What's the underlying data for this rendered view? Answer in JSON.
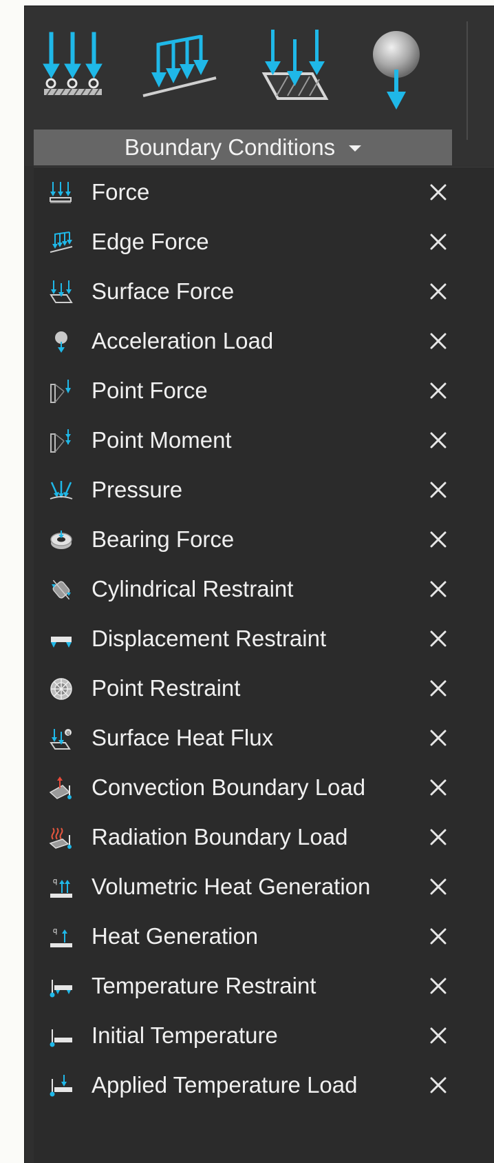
{
  "ribbon": {
    "group_label": "Boundary Conditions",
    "icons": [
      "force-icon",
      "edge-force-icon",
      "surface-force-icon",
      "acceleration-load-icon"
    ]
  },
  "menu": {
    "items": [
      {
        "label": "Force",
        "icon": "force-icon"
      },
      {
        "label": "Edge Force",
        "icon": "edge-force-icon"
      },
      {
        "label": "Surface Force",
        "icon": "surface-force-icon"
      },
      {
        "label": "Acceleration Load",
        "icon": "acceleration-load-icon"
      },
      {
        "label": "Point Force",
        "icon": "point-force-icon"
      },
      {
        "label": "Point Moment",
        "icon": "point-moment-icon"
      },
      {
        "label": "Pressure",
        "icon": "pressure-icon"
      },
      {
        "label": "Bearing Force",
        "icon": "bearing-force-icon"
      },
      {
        "label": "Cylindrical Restraint",
        "icon": "cylindrical-restraint-icon"
      },
      {
        "label": "Displacement Restraint",
        "icon": "displacement-restraint-icon"
      },
      {
        "label": "Point Restraint",
        "icon": "point-restraint-icon"
      },
      {
        "label": "Surface Heat Flux",
        "icon": "surface-heat-flux-icon"
      },
      {
        "label": "Convection Boundary Load",
        "icon": "convection-boundary-load-icon"
      },
      {
        "label": "Radiation Boundary Load",
        "icon": "radiation-boundary-load-icon"
      },
      {
        "label": "Volumetric Heat Generation",
        "icon": "volumetric-heat-generation-icon"
      },
      {
        "label": "Heat Generation",
        "icon": "heat-generation-icon"
      },
      {
        "label": "Temperature Restraint",
        "icon": "temperature-restraint-icon"
      },
      {
        "label": "Initial Temperature",
        "icon": "initial-temperature-icon"
      },
      {
        "label": "Applied Temperature Load",
        "icon": "applied-temperature-load-icon"
      }
    ]
  },
  "colors": {
    "accent": "#1fb8e8",
    "panel": "#2f2f2f",
    "menu": "#2b2b2b",
    "group_label_bg": "#666666",
    "text": "#f0f0f0"
  }
}
